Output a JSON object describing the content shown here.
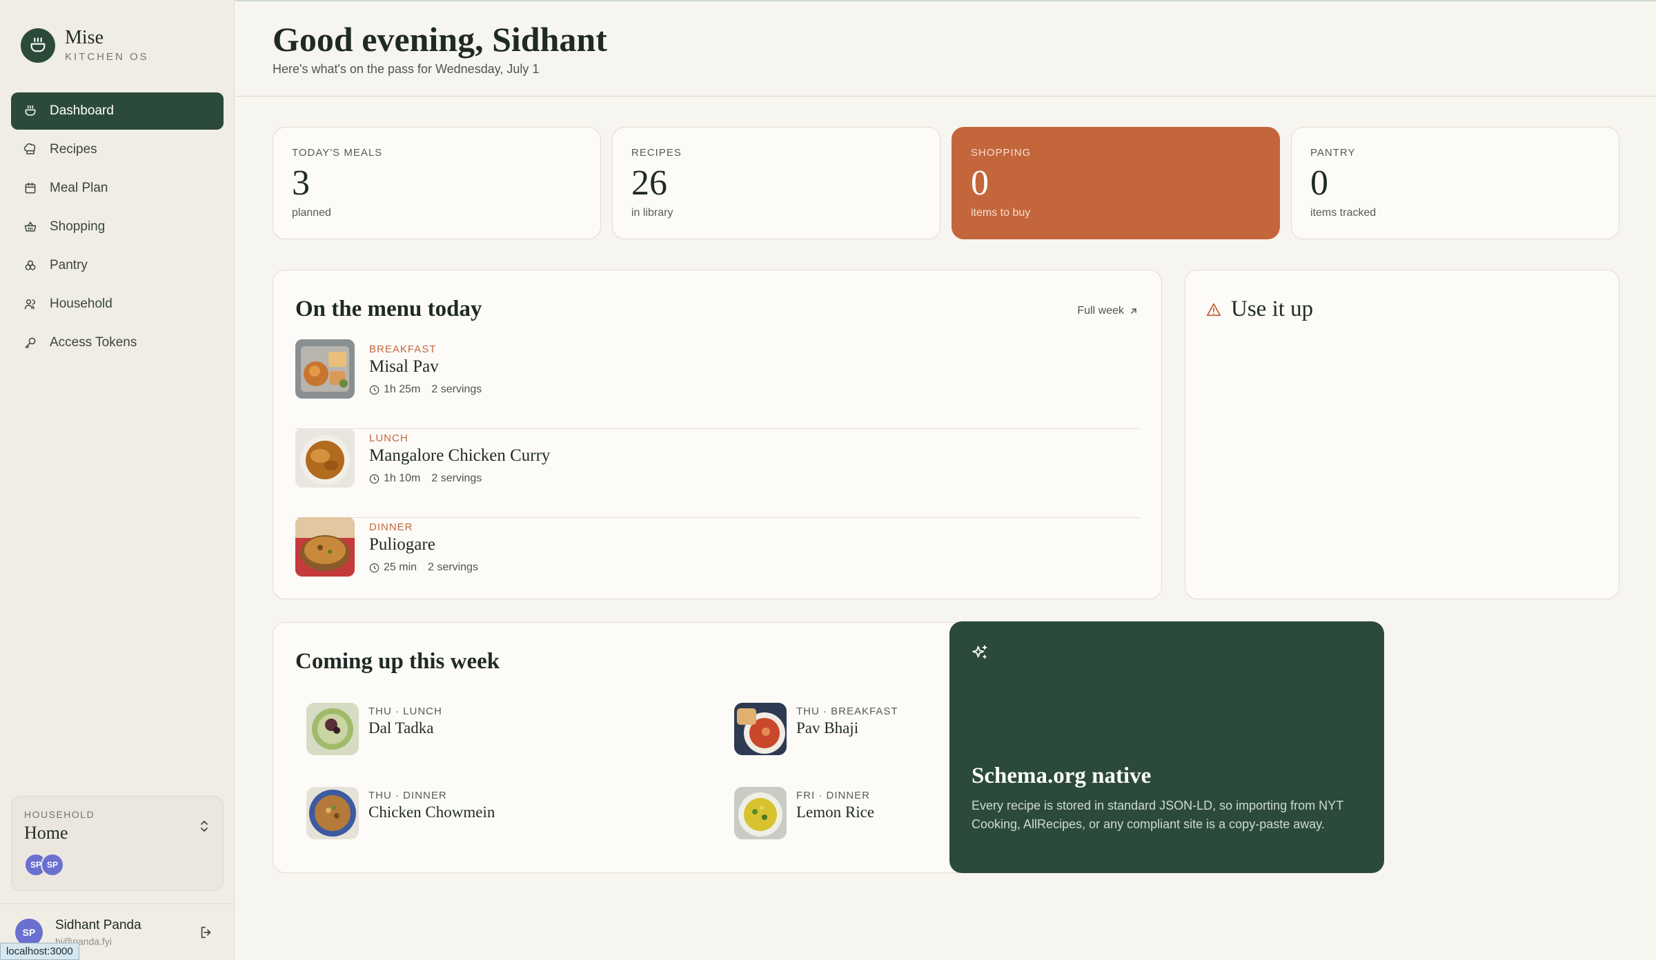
{
  "brand": {
    "name": "Mise",
    "subtitle": "KITCHEN OS"
  },
  "nav": [
    {
      "label": "Dashboard",
      "icon": "pot-icon",
      "active": true
    },
    {
      "label": "Recipes",
      "icon": "chef-hat-icon"
    },
    {
      "label": "Meal Plan",
      "icon": "calendar-icon"
    },
    {
      "label": "Shopping",
      "icon": "basket-icon"
    },
    {
      "label": "Pantry",
      "icon": "jars-icon"
    },
    {
      "label": "Household",
      "icon": "users-icon"
    },
    {
      "label": "Access Tokens",
      "icon": "key-icon"
    }
  ],
  "household": {
    "label": "HOUSEHOLD",
    "name": "Home",
    "avatars": [
      "SP",
      "SP"
    ]
  },
  "user": {
    "initials": "SP",
    "name": "Sidhant Panda",
    "email": "hi@panda.fyi"
  },
  "status_url": "localhost:3000",
  "header": {
    "greeting": "Good evening, Sidhant",
    "subtitle": "Here's what's on the pass for Wednesday, July 1"
  },
  "stats": [
    {
      "label": "TODAY'S MEALS",
      "value": "3",
      "sub": "planned"
    },
    {
      "label": "RECIPES",
      "value": "26",
      "sub": "in library"
    },
    {
      "label": "SHOPPING",
      "value": "0",
      "sub": "items to buy"
    },
    {
      "label": "PANTRY",
      "value": "0",
      "sub": "items tracked"
    }
  ],
  "today": {
    "title": "On the menu today",
    "full_week": "Full week",
    "meals": [
      {
        "slot": "BREAKFAST",
        "name": "Misal Pav",
        "time": "1h 25m",
        "servings": "2 servings"
      },
      {
        "slot": "LUNCH",
        "name": "Mangalore Chicken Curry",
        "time": "1h 10m",
        "servings": "2 servings"
      },
      {
        "slot": "DINNER",
        "name": "Puliogare",
        "time": "25 min",
        "servings": "2 servings"
      }
    ]
  },
  "use_it_up": {
    "title": "Use it up"
  },
  "week": {
    "title": "Coming up this week",
    "items": [
      {
        "slot": "THU · LUNCH",
        "name": "Dal Tadka"
      },
      {
        "slot": "THU · BREAKFAST",
        "name": "Pav Bhaji"
      },
      {
        "slot": "THU · DINNER",
        "name": "Chicken Chowmein"
      },
      {
        "slot": "FRI · DINNER",
        "name": "Lemon Rice"
      }
    ]
  },
  "schema": {
    "title": "Schema.org native",
    "body": "Every recipe is stored in standard JSON-LD, so importing from NYT Cooking, AllRecipes, or any compliant site is a copy-paste away."
  },
  "colors": {
    "brand_green": "#2c4a39",
    "accent_orange": "#c4663c",
    "background": "#f7f5ef"
  }
}
